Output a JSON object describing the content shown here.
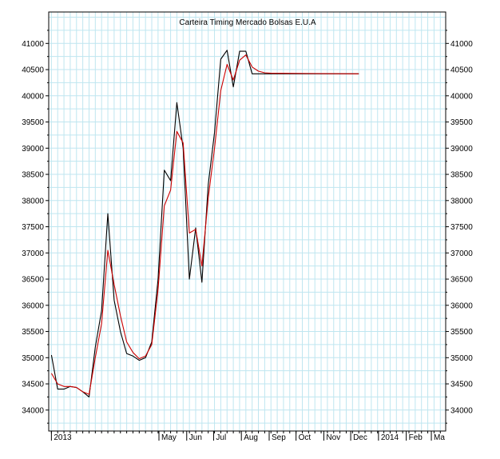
{
  "chart_data": {
    "type": "line",
    "title": "Carteira Timing Mercado Bolsas E.U.A",
    "xlabel": "",
    "ylabel": "",
    "ylim": [
      33600,
      41600
    ],
    "xlim": [
      "2012-12-29",
      "2014-03-17"
    ],
    "grid": true,
    "legend": "none",
    "x_tick_labels": [
      {
        "date": "2013-01-01",
        "label": "2013"
      },
      {
        "date": "2013-05-01",
        "label": "May"
      },
      {
        "date": "2013-06-01",
        "label": "Jun"
      },
      {
        "date": "2013-07-01",
        "label": "Jul"
      },
      {
        "date": "2013-08-01",
        "label": "Aug"
      },
      {
        "date": "2013-09-01",
        "label": "Sep"
      },
      {
        "date": "2013-10-01",
        "label": "Oct"
      },
      {
        "date": "2013-11-01",
        "label": "Nov"
      },
      {
        "date": "2013-12-01",
        "label": "Dec"
      },
      {
        "date": "2014-01-01",
        "label": "2014"
      },
      {
        "date": "2014-02-01",
        "label": "Feb"
      },
      {
        "date": "2014-03-01",
        "label": "Ma"
      }
    ],
    "y_ticks": [
      34000,
      34500,
      35000,
      35500,
      36000,
      36500,
      37000,
      37500,
      38000,
      38500,
      39000,
      39500,
      40000,
      40500,
      41000
    ],
    "series": [
      {
        "color": "#000000",
        "points": [
          [
            "2013-01-01",
            35050
          ],
          [
            "2013-01-08",
            34400
          ],
          [
            "2013-01-15",
            34400
          ],
          [
            "2013-01-22",
            34450
          ],
          [
            "2013-01-29",
            34430
          ],
          [
            "2013-02-05",
            34350
          ],
          [
            "2013-02-12",
            34250
          ],
          [
            "2013-02-19",
            35200
          ],
          [
            "2013-02-26",
            35900
          ],
          [
            "2013-03-05",
            37750
          ],
          [
            "2013-03-12",
            36100
          ],
          [
            "2013-03-19",
            35500
          ],
          [
            "2013-03-26",
            35080
          ],
          [
            "2013-04-02",
            35030
          ],
          [
            "2013-04-09",
            34950
          ],
          [
            "2013-04-16",
            35000
          ],
          [
            "2013-04-23",
            35300
          ],
          [
            "2013-04-30",
            36500
          ],
          [
            "2013-05-07",
            38580
          ],
          [
            "2013-05-14",
            38380
          ],
          [
            "2013-05-21",
            39870
          ],
          [
            "2013-05-28",
            39000
          ],
          [
            "2013-06-04",
            36500
          ],
          [
            "2013-06-11",
            37480
          ],
          [
            "2013-06-18",
            36440
          ],
          [
            "2013-06-25",
            38300
          ],
          [
            "2013-07-02",
            39300
          ],
          [
            "2013-07-09",
            40700
          ],
          [
            "2013-07-16",
            40870
          ],
          [
            "2013-07-23",
            40170
          ],
          [
            "2013-07-30",
            40850
          ],
          [
            "2013-08-06",
            40850
          ],
          [
            "2013-08-13",
            40420
          ],
          [
            "2013-08-20",
            40420
          ],
          [
            "2013-08-27",
            40420
          ],
          [
            "2013-09-03",
            40420
          ],
          [
            "2013-12-10",
            40420
          ]
        ]
      },
      {
        "color": "#cc0000",
        "points": [
          [
            "2013-01-01",
            34700
          ],
          [
            "2013-01-08",
            34500
          ],
          [
            "2013-01-15",
            34450
          ],
          [
            "2013-01-22",
            34450
          ],
          [
            "2013-01-29",
            34430
          ],
          [
            "2013-02-05",
            34350
          ],
          [
            "2013-02-12",
            34300
          ],
          [
            "2013-02-19",
            35000
          ],
          [
            "2013-02-26",
            35650
          ],
          [
            "2013-03-05",
            37050
          ],
          [
            "2013-03-12",
            36400
          ],
          [
            "2013-03-19",
            35800
          ],
          [
            "2013-03-26",
            35300
          ],
          [
            "2013-04-02",
            35100
          ],
          [
            "2013-04-09",
            34980
          ],
          [
            "2013-04-16",
            35030
          ],
          [
            "2013-04-23",
            35250
          ],
          [
            "2013-04-30",
            36300
          ],
          [
            "2013-05-07",
            37900
          ],
          [
            "2013-05-14",
            38200
          ],
          [
            "2013-05-21",
            39320
          ],
          [
            "2013-05-28",
            39100
          ],
          [
            "2013-06-04",
            37380
          ],
          [
            "2013-06-11",
            37450
          ],
          [
            "2013-06-18",
            36750
          ],
          [
            "2013-06-25",
            38050
          ],
          [
            "2013-07-02",
            39000
          ],
          [
            "2013-07-09",
            40100
          ],
          [
            "2013-07-16",
            40600
          ],
          [
            "2013-07-23",
            40300
          ],
          [
            "2013-07-30",
            40680
          ],
          [
            "2013-08-06",
            40780
          ],
          [
            "2013-08-13",
            40550
          ],
          [
            "2013-08-20",
            40470
          ],
          [
            "2013-08-27",
            40440
          ],
          [
            "2013-09-03",
            40430
          ],
          [
            "2013-12-10",
            40420
          ]
        ]
      }
    ]
  }
}
